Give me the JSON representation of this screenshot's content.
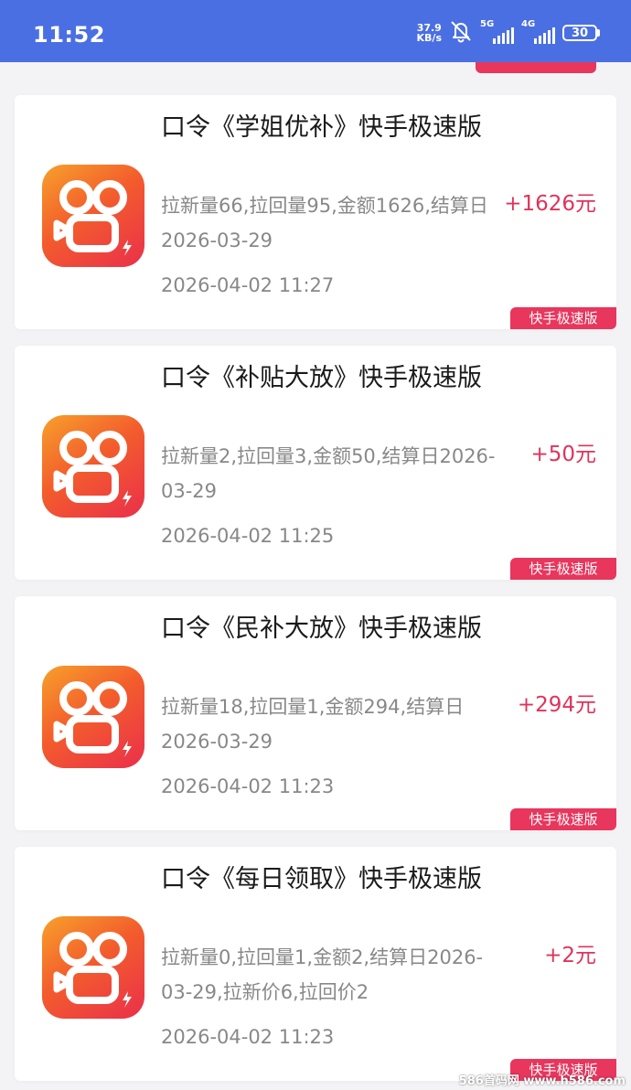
{
  "status_bar": {
    "time": "11:52",
    "net_speed_value": "37.9",
    "net_speed_unit": "KB/s",
    "signal_1_label": "5G",
    "signal_2_label": "4G",
    "battery": "30",
    "icons": [
      "mute-bell-icon",
      "signal-icon",
      "battery-icon"
    ],
    "background_color": "#4a6fe3"
  },
  "accent_color": "#e0335a",
  "records": [
    {
      "title": "口令《学姐优补》快手极速版",
      "desc": "拉新量66,拉回量95,金额1626,结算日2026-03-29",
      "time": "2026-04-02 11:27",
      "amount": "+1626元",
      "tag": "快手极速版",
      "icon": "kuaishou-app-icon"
    },
    {
      "title": "口令《补贴大放》快手极速版",
      "desc": "拉新量2,拉回量3,金额50,结算日2026-03-29",
      "time": "2026-04-02 11:25",
      "amount": "+50元",
      "tag": "快手极速版",
      "icon": "kuaishou-app-icon"
    },
    {
      "title": "口令《民补大放》快手极速版",
      "desc": "拉新量18,拉回量1,金额294,结算日2026-03-29",
      "time": "2026-04-02 11:23",
      "amount": "+294元",
      "tag": "快手极速版",
      "icon": "kuaishou-app-icon"
    },
    {
      "title": "口令《每日领取》快手极速版",
      "desc": "拉新量0,拉回量1,金额2,结算日2026-03-29,拉新价6,拉回价2",
      "time": "2026-04-02 11:23",
      "amount": "+2元",
      "tag": "快手极速版",
      "icon": "kuaishou-app-icon"
    }
  ],
  "watermark": "586首码网 www.h586.com"
}
